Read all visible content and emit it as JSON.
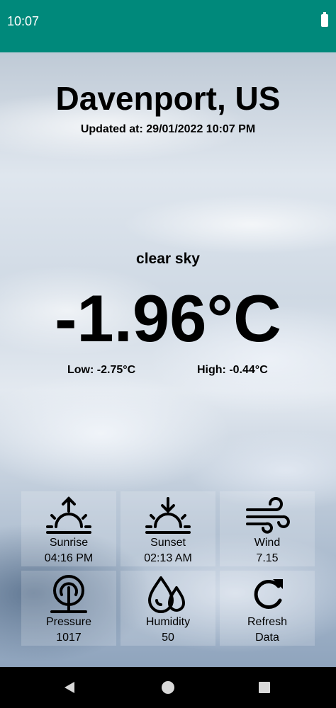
{
  "status_bar": {
    "time": "10:07"
  },
  "weather": {
    "city": "Davenport, US",
    "updated_at": "Updated at: 29/01/2022 10:07 PM",
    "status": "clear sky",
    "temperature": "-1.96°C",
    "temp_min": "Low: -2.75°C",
    "temp_max": "High: -0.44°C"
  },
  "details": [
    {
      "label": "Sunrise",
      "value": "04:16 PM",
      "icon": "sunrise-icon"
    },
    {
      "label": "Sunset",
      "value": "02:13 AM",
      "icon": "sunset-icon"
    },
    {
      "label": "Wind",
      "value": "7.15",
      "icon": "wind-icon"
    },
    {
      "label": "Pressure",
      "value": "1017",
      "icon": "pressure-icon"
    },
    {
      "label": "Humidity",
      "value": "50",
      "icon": "humidity-icon"
    },
    {
      "label": "Refresh",
      "value": "Data",
      "icon": "refresh-icon"
    }
  ],
  "navigation": {
    "back": "back-icon",
    "home": "home-icon",
    "recents": "recents-icon"
  }
}
